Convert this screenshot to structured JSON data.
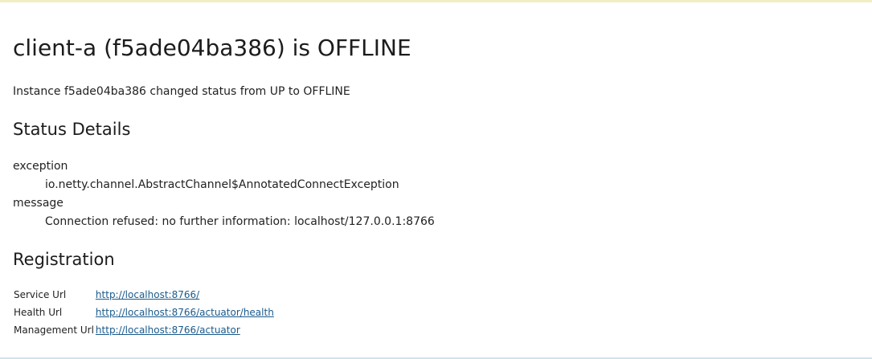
{
  "title": "client-a (f5ade04ba386) is OFFLINE",
  "summary": "Instance f5ade04ba386 changed status from UP to OFFLINE",
  "status_details": {
    "heading": "Status Details",
    "items": [
      {
        "key": "exception",
        "value": "io.netty.channel.AbstractChannel$AnnotatedConnectException"
      },
      {
        "key": "message",
        "value": "Connection refused: no further information: localhost/127.0.0.1:8766"
      }
    ]
  },
  "registration": {
    "heading": "Registration",
    "rows": [
      {
        "label": "Service Url",
        "url": "http://localhost:8766/"
      },
      {
        "label": "Health Url",
        "url": "http://localhost:8766/actuator/health"
      },
      {
        "label": "Management Url",
        "url": "http://localhost:8766/actuator"
      }
    ]
  }
}
